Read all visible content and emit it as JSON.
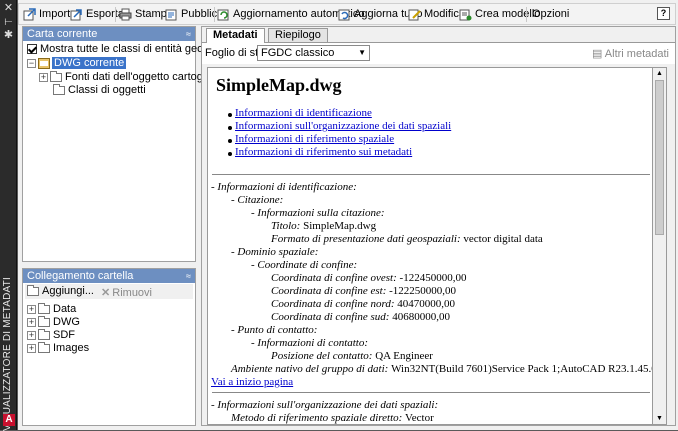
{
  "side_strip": {
    "title": "VISUALIZZATORE DI METADATI",
    "close_glyph": "✕",
    "pin_glyph": "⊢",
    "settings_glyph": "✱",
    "logo": "A"
  },
  "toolbar": {
    "items": [
      "Importa",
      "Esporta",
      "Stampa",
      "Pubblica",
      "Aggiornamento automatico",
      "Aggiorna tutto",
      "Modifica",
      "Crea modello",
      "Opzioni"
    ],
    "help": "?"
  },
  "carta": {
    "title": "Carta corrente",
    "collapse": "≈",
    "show_all": "Mostra tutte le classi di entità geografic",
    "root": "DWG corrente",
    "children": [
      "Fonti dati dell'oggetto cartografico",
      "Classi di oggetti"
    ]
  },
  "collegamento": {
    "title": "Collegamento cartella",
    "collapse": "≈",
    "add": "Aggiungi...",
    "remove": "Rimuovi",
    "folders": [
      "Data",
      "DWG",
      "SDF",
      "Images"
    ]
  },
  "right": {
    "tabs": [
      "Metadati",
      "Riepilogo"
    ],
    "style_label": "Foglio di stile:",
    "style_value": "FGDC classico",
    "other": "Altri metadati"
  },
  "doc": {
    "title": "SimpleMap.dwg",
    "toc": [
      "Informazioni di identificazione",
      "Informazioni sull'organizzazione dei dati spaziali",
      "Informazioni di riferimento spaziale",
      "Informazioni di riferimento sui metadati"
    ],
    "lines": [
      {
        "label": "- Informazioni di identificazione:",
        "value": ""
      },
      {
        "label": "- Citazione:",
        "value": ""
      },
      {
        "label": "- Informazioni sulla citazione:",
        "value": ""
      },
      {
        "label": "Titolo:",
        "value": "SimpleMap.dwg"
      },
      {
        "label": "Formato di presentazione dati geospaziali:",
        "value": "vector digital data"
      },
      {
        "label": "- Dominio spaziale:",
        "value": ""
      },
      {
        "label": "- Coordinate di confine:",
        "value": ""
      },
      {
        "label": "Coordinata di confine ovest:",
        "value": "-122450000,00"
      },
      {
        "label": "Coordinata di confine est:",
        "value": "-122250000,00"
      },
      {
        "label": "Coordinata di confine nord:",
        "value": "40470000,00"
      },
      {
        "label": "Coordinata di confine sud:",
        "value": "40680000,00"
      },
      {
        "label": "- Punto di contatto:",
        "value": ""
      },
      {
        "label": "- Informazioni di contatto:",
        "value": ""
      },
      {
        "label": "Posizione del contatto:",
        "value": "QA Engineer"
      },
      {
        "label": "Ambiente nativo del gruppo di dati:",
        "value": "Win32NT(Build 7601)Service Pack 1;AutoCAD R23.1.45.0.0"
      }
    ],
    "back_link": "Vai a inizio pagina",
    "lines2": [
      {
        "label": "- Informazioni sull'organizzazione dei dati spaziali:",
        "value": ""
      },
      {
        "label": "Metodo di riferimento spaziale diretto:",
        "value": "Vector"
      }
    ]
  }
}
